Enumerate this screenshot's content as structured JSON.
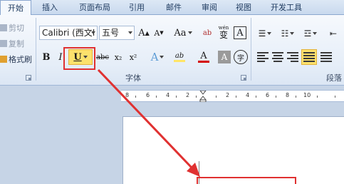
{
  "tabs": [
    "开始",
    "插入",
    "页面布局",
    "引用",
    "邮件",
    "审阅",
    "视图",
    "开发工具"
  ],
  "clipboard": {
    "cut_label": "剪切",
    "copy_label": "复制",
    "format_painter_label": "格式刷"
  },
  "font": {
    "font_name": "Calibri (西文I",
    "font_size": "五号",
    "grow_label": "A",
    "shrink_label": "A",
    "change_case_label": "Aa",
    "clear_label": "ab",
    "phonetic_label": "wén",
    "phonetic_char": "变",
    "border_label": "A",
    "bold_label": "B",
    "italic_label": "I",
    "underline_label": "U",
    "strike_label": "abc",
    "subscript_label": "x₂",
    "superscript_label": "x²",
    "effects_label": "A",
    "highlight_label": "ab",
    "color_label": "A",
    "shading_label": "A",
    "enclose_label": "字",
    "group_label": "字体"
  },
  "paragraph": {
    "group_label": "段落"
  },
  "ruler": {
    "numbers": [
      "8",
      "6",
      "4",
      "2",
      "2",
      "4",
      "6",
      "8",
      "10"
    ]
  },
  "colors": {
    "highlight_yellow": "#ffe566",
    "font_red": "#d40000",
    "annotation_red": "#e03131",
    "underline_selected": "#fce16c"
  }
}
